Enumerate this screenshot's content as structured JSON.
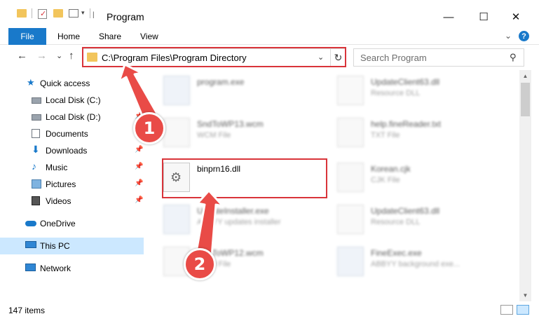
{
  "window": {
    "title": "Program",
    "minimize_glyph": "—",
    "maximize_glyph": "☐",
    "close_glyph": "✕"
  },
  "ribbon": {
    "tabs": [
      "File",
      "Home",
      "Share",
      "View"
    ],
    "expand_glyph": "⌄",
    "help_glyph": "?"
  },
  "nav": {
    "back_glyph": "←",
    "forward_glyph": "→",
    "recent_glyph": "⌄",
    "up_glyph": "↑",
    "address": "C:\\Program Files\\Program Directory",
    "dropdown_glyph": "⌄",
    "refresh_glyph": "↻",
    "search_placeholder": "Search Program",
    "search_glyph": "⚲"
  },
  "sidebar": {
    "items": [
      {
        "label": "Quick access",
        "icon": "star-icon"
      },
      {
        "label": "Local Disk (C:)",
        "icon": "drive-icon"
      },
      {
        "label": "Local Disk (D:)",
        "icon": "drive-icon"
      },
      {
        "label": "Documents",
        "icon": "documents-icon"
      },
      {
        "label": "Downloads",
        "icon": "downloads-icon"
      },
      {
        "label": "Music",
        "icon": "music-icon"
      },
      {
        "label": "Pictures",
        "icon": "pictures-icon"
      },
      {
        "label": "Videos",
        "icon": "videos-icon"
      },
      {
        "label": "OneDrive",
        "icon": "cloud-icon"
      },
      {
        "label": "This PC",
        "icon": "computer-icon"
      },
      {
        "label": "Network",
        "icon": "network-icon"
      }
    ],
    "pin_glyph": "📌"
  },
  "files": [
    {
      "name": "program.exe",
      "desc": ""
    },
    {
      "name": "UpdateClient63.dll",
      "desc": "Resource DLL"
    },
    {
      "name": "SndToWP13.wcm",
      "desc": "WCM File"
    },
    {
      "name": "help.fineReader.txt",
      "desc": "TXT File"
    },
    {
      "name": "binprn16.dll",
      "desc": ""
    },
    {
      "name": "Korean.cjk",
      "desc": "CJK File"
    },
    {
      "name": "UpdateInstaller.exe",
      "desc": "ABBYY updates installer"
    },
    {
      "name": "UpdateClient63.dll",
      "desc": "Resource DLL"
    },
    {
      "name": "SndToWP12.wcm",
      "desc": "WCM File"
    },
    {
      "name": "FineExec.exe",
      "desc": "ABBYY background exe..."
    }
  ],
  "annotations": {
    "step1": "1",
    "step2": "2",
    "color": "#e94b47"
  },
  "scrollbar": {
    "up_glyph": "▲",
    "down_glyph": "▼"
  },
  "status": {
    "item_count": "147 items"
  },
  "colors": {
    "accent": "#1979ca",
    "highlight": "#d9343a",
    "selected": "#cce8ff"
  }
}
